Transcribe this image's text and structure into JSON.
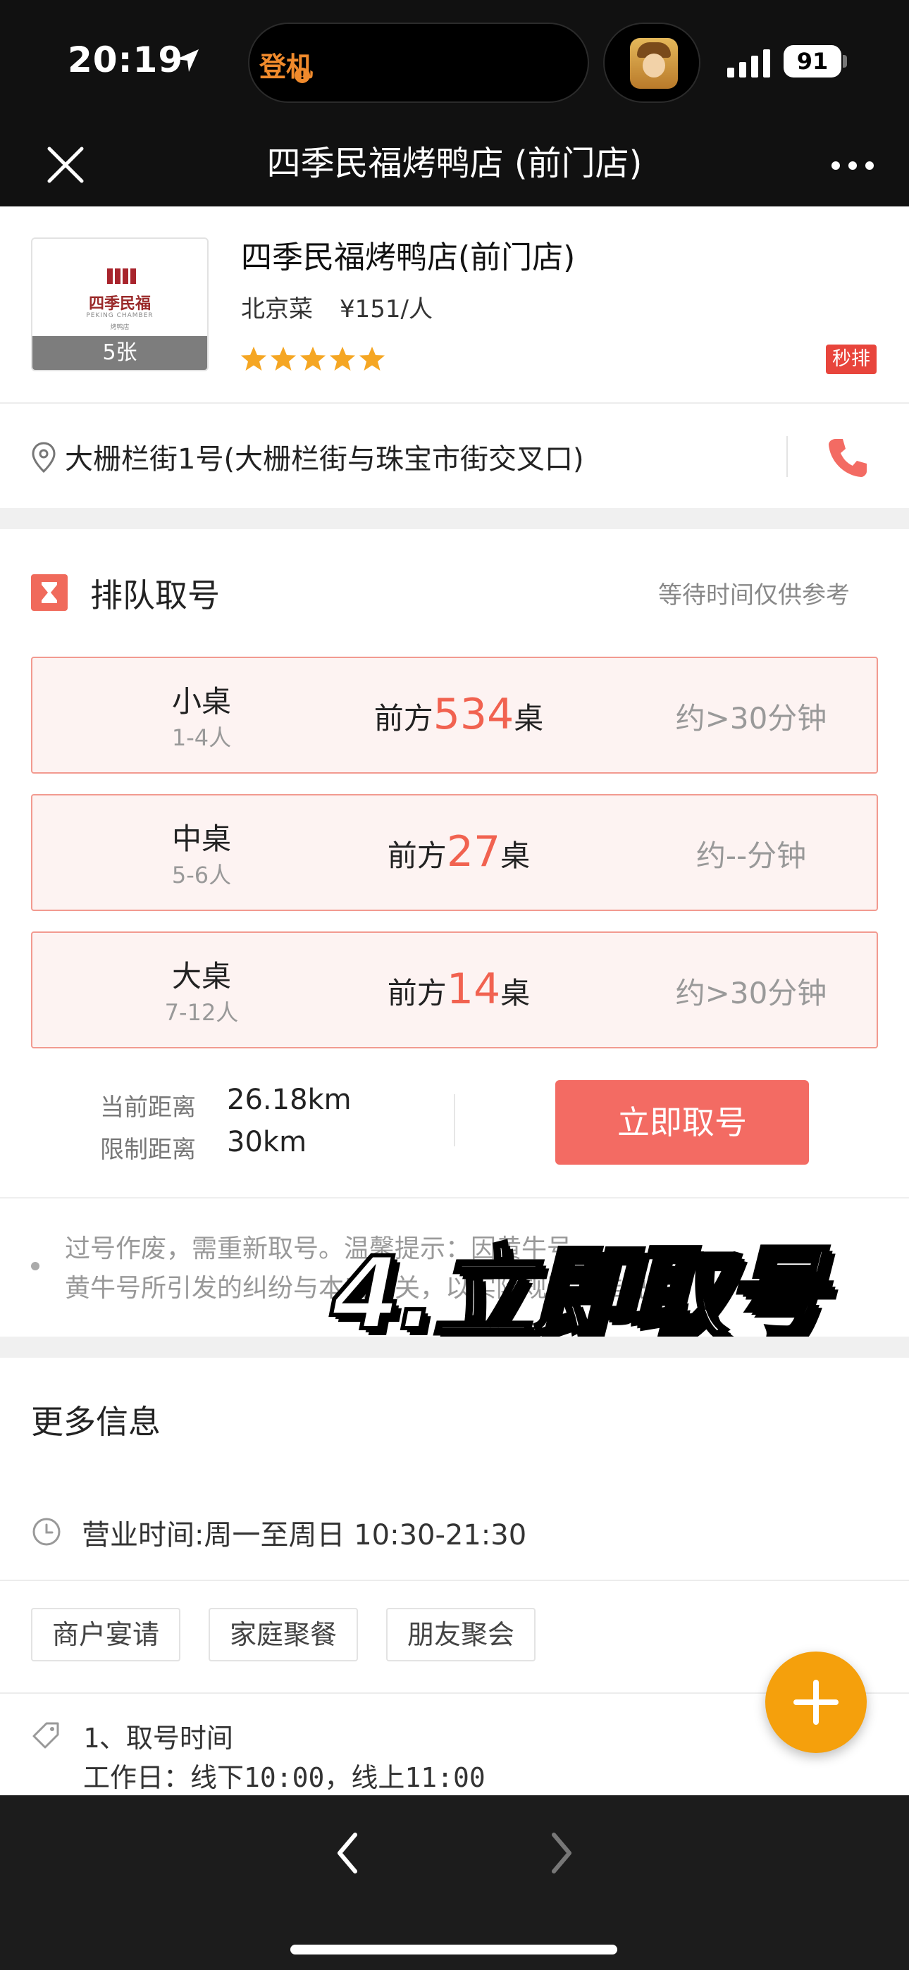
{
  "status_bar": {
    "time": "20:19",
    "island_label": "登机",
    "island_badge": "!",
    "battery": "91",
    "icons": [
      "location-arrow-icon",
      "signal-icon",
      "battery-icon"
    ]
  },
  "nav": {
    "title": "四季民福烤鸭店 (前门店)",
    "icons": [
      "close-icon",
      "more-icon"
    ]
  },
  "shop": {
    "logo_cn": "四季民福",
    "logo_en": "PEKING CHAMBER",
    "logo_sub": "烤鸭店",
    "photo_count": "5张",
    "name": "四季民福烤鸭店(前门店)",
    "cuisine": "北京菜",
    "price": "¥151/人",
    "rating_stars": 5,
    "instant_tag": "秒排",
    "star_color": "#f5a623"
  },
  "address": {
    "text": "大栅栏街1号(大栅栏街与珠宝市街交叉口)",
    "icons": [
      "location-pin-icon",
      "phone-icon"
    ],
    "accent_color": "#f36b63"
  },
  "queue": {
    "title": "排队取号",
    "note": "等待时间仅供参考",
    "tables": [
      {
        "type": "小桌",
        "size": "1-4人",
        "ahead_prefix": "前方",
        "ahead_num": "534",
        "ahead_suffix": "桌",
        "wait": "约>30分钟"
      },
      {
        "type": "中桌",
        "size": "5-6人",
        "ahead_prefix": "前方",
        "ahead_num": "27",
        "ahead_suffix": "桌",
        "wait": "约--分钟"
      },
      {
        "type": "大桌",
        "size": "7-12人",
        "ahead_prefix": "前方",
        "ahead_num": "14",
        "ahead_suffix": "桌",
        "wait": "约>30分钟"
      }
    ],
    "current_distance_label": "当前距离",
    "current_distance": "26.18km",
    "limit_distance_label": "限制距离",
    "limit_distance": "30km",
    "take_button": "立即取号"
  },
  "notice": {
    "line1": "过号作废，需重新取号。温馨提示：因黄牛号",
    "line2": "黄牛号所引发的纠纷与本店无关，以实际规则为准说明"
  },
  "overlay_caption": "4.立即取号",
  "more_info": {
    "title": "更多信息",
    "hours": "营业时间:周一至周日 10:30-21:30",
    "tags": [
      "商户宴请",
      "家庭聚餐",
      "朋友聚会"
    ],
    "rule_title": "1、取号时间",
    "rule_line": "工作日：线下10:00，线上11:00"
  },
  "bottom_bar": {
    "icons": [
      "back-arrow-icon",
      "forward-arrow-icon"
    ]
  }
}
